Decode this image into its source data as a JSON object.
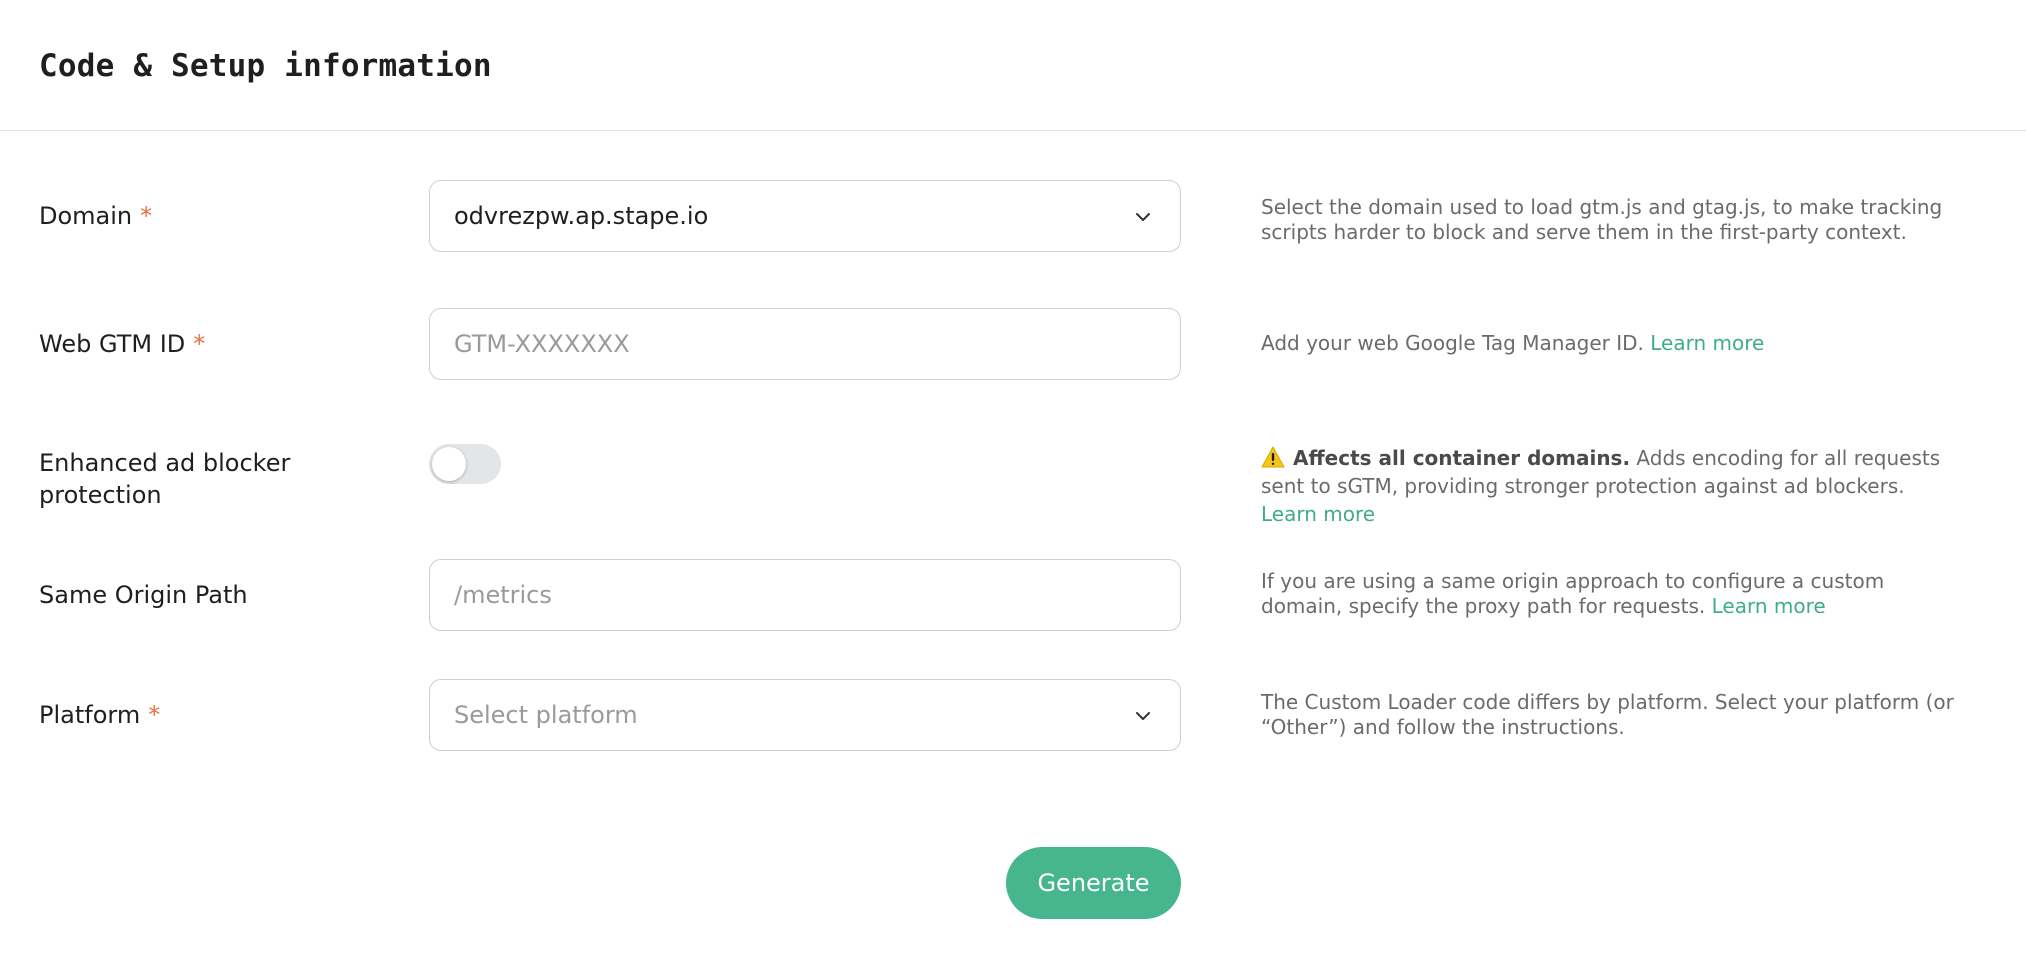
{
  "header": {
    "title": "Code & Setup information"
  },
  "form": {
    "domain": {
      "label": "Domain",
      "required_mark": "*",
      "value": "odvrezpw.ap.stape.io",
      "help": "Select the domain used to load gtm.js and gtag.js, to make tracking scripts harder to block and serve them in the first-party context."
    },
    "web_gtm_id": {
      "label": "Web GTM ID",
      "required_mark": "*",
      "placeholder": "GTM-XXXXXXX",
      "help": "Add your web Google Tag Manager ID.",
      "help_link": "Learn more"
    },
    "ad_blocker": {
      "label": "Enhanced ad blocker protection",
      "enabled": false,
      "help_strong": "Affects all container domains.",
      "help": "Adds encoding for all requests sent to sGTM, providing stronger protection against ad blockers.",
      "help_link": "Learn more",
      "warning_icon": "warning-icon",
      "warning_color": "#f5c518"
    },
    "same_origin_path": {
      "label": "Same Origin Path",
      "placeholder": "/metrics",
      "help": "If you are using a same origin approach to configure a custom domain, specify the proxy path for requests.",
      "help_link": "Learn more"
    },
    "platform": {
      "label": "Platform",
      "required_mark": "*",
      "placeholder": "Select platform",
      "help": "The Custom Loader code differs by platform. Select your platform (or “Other”) and follow the instructions."
    }
  },
  "actions": {
    "generate_label": "Generate"
  },
  "colors": {
    "accent": "#47b68e",
    "link": "#3fae85",
    "required": "#e8703a"
  }
}
